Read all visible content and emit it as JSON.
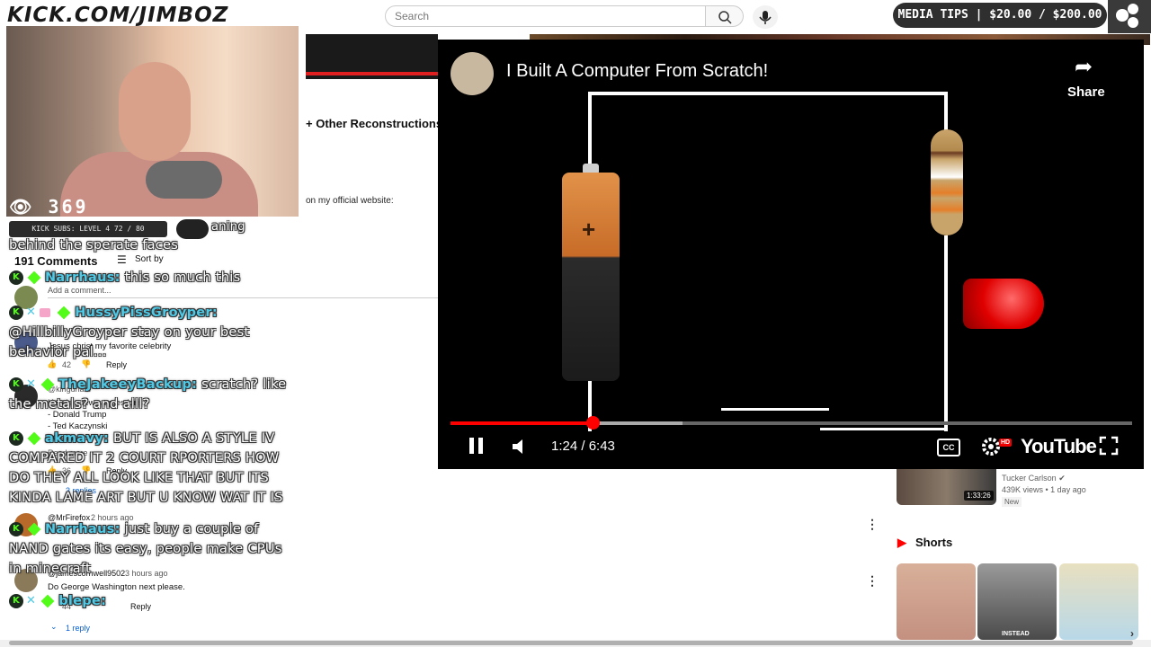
{
  "brand": "KICK.COM/JIMBOZ",
  "search": {
    "placeholder": "Search"
  },
  "media_tips": "MEDIA TIPS | $20.00 / $200.00",
  "stream": {
    "viewers": "369",
    "kick_subs": "KICK SUBS: LEVEL 4 72 / 80"
  },
  "page": {
    "video_title_fragment": "+ Other Reconstructions)",
    "description_fragment": "on my official website:"
  },
  "comments": {
    "count_label": "191 Comments",
    "sort_label": "Sort by",
    "add_placeholder": "Add a comment...",
    "items": [
      {
        "text": "Jesus christ my favorite celebrity",
        "likes": "42",
        "reply": "Reply"
      },
      {
        "author": "@kinguna...",
        "lines": [
          "Here's a few suggestions:",
          "- Donald Trump",
          "- Ted Kaczynski",
          "- Osama..."
        ],
        "read_more": "Read more",
        "likes": "36",
        "reply": "Reply",
        "replies": "3 replies"
      },
      {
        "author": "@MrFirefox",
        "time": "2 hours ago"
      },
      {
        "author": "@jamescornwell9502",
        "time": "3 hours ago",
        "text": "Do George Washington next please.",
        "likes": "44",
        "reply": "Reply",
        "replies": "1 reply"
      }
    ]
  },
  "chat": [
    {
      "prefix_text": "behind the sperate faces"
    },
    {
      "user": "Narrhaus:",
      "message": "this so much this"
    },
    {
      "user": "HussyPissGroyper:",
      "message": "@HillbillyGroyper stay on your best behavior pal..."
    },
    {
      "user": "TheJakeeyBackup:",
      "message": "scratch? like the metals? and alll?"
    },
    {
      "user": "akmavy:",
      "message": "BUT IS ALSO A STYLE IV COMPARED IT 2 COURT RPORTERS HOW DO THEY ALL LOOK LIKE THAT BUT ITS KINDA LAME ART BUT U KNOW WAT IT IS"
    },
    {
      "user": "Narrhaus:",
      "message": "just buy a couple of NAND gates its easy, people make CPUs in minecraft"
    },
    {
      "user": "blepe:",
      "message": ""
    }
  ],
  "chat_fragment": "aning",
  "player": {
    "title": "I Built A Computer From Scratch!",
    "share": "Share",
    "time": "1:24 / 6:43",
    "progress": 0.208,
    "buffered": 0.34,
    "logo": "YouTube",
    "hd": "HD",
    "cc": "CC"
  },
  "recommended": {
    "channel": "Tucker Carlson",
    "meta": "439K views • 1 day ago",
    "badge": "New",
    "duration": "1:33:26"
  },
  "shorts": {
    "label": "Shorts",
    "caption": "INSTEAD"
  },
  "colors": {
    "accent_red": "#ff0000",
    "kick_green": "#53fc18",
    "chat_nick": "#4ec9e6"
  }
}
